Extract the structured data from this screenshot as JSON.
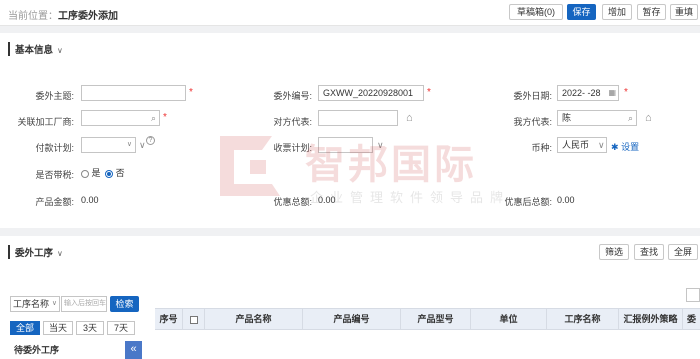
{
  "breadcrumb": {
    "prefix": "当前位置：",
    "title": "工序委外添加"
  },
  "toolbar": {
    "draft": "草稿箱(0)",
    "save": "保存",
    "add": "增加",
    "hold": "暂存",
    "refresh": "重填"
  },
  "basic": {
    "title": "基本信息",
    "subject_label": "委外主题:",
    "factory_label": "关联加工厂商:",
    "payment_label": "付款计划:",
    "tax_label": "是否带税:",
    "tax_yes": "是",
    "tax_no": "否",
    "product_amount_label": "产品金额:",
    "product_amount": "0.00",
    "code_label": "委外编号:",
    "code_value": "GXWW_20220928001",
    "counterpart_label": "对方代表:",
    "receipt_label": "收票计划:",
    "discount_label": "优惠总额:",
    "discount_value": "0.00",
    "date_label": "委外日期:",
    "date_value": "2022-     -28",
    "our_rep_label": "我方代表:",
    "our_rep_value": "陈",
    "currency_label": "币种:",
    "currency_value": "人民币",
    "settings_link": "设置",
    "after_discount_label": "优惠后总额:",
    "after_discount_value": "0.00"
  },
  "watermark": {
    "main": "智邦国际",
    "sub": "企业管理软件领导品牌"
  },
  "process": {
    "title": "委外工序",
    "filter": "筛选",
    "find": "查找",
    "fullscreen": "全屏",
    "search_select": "工序名称",
    "search_placeholder": "输入后按回车",
    "search_button": "检索",
    "tabs": [
      "全部",
      "当天",
      "3天",
      "7天"
    ],
    "pending_title": "待委外工序",
    "collapse": "«",
    "columns": [
      "序号",
      "",
      "产品名称",
      "产品编号",
      "产品型号",
      "单位",
      "工序名称",
      "汇报例外策略",
      "委"
    ]
  }
}
